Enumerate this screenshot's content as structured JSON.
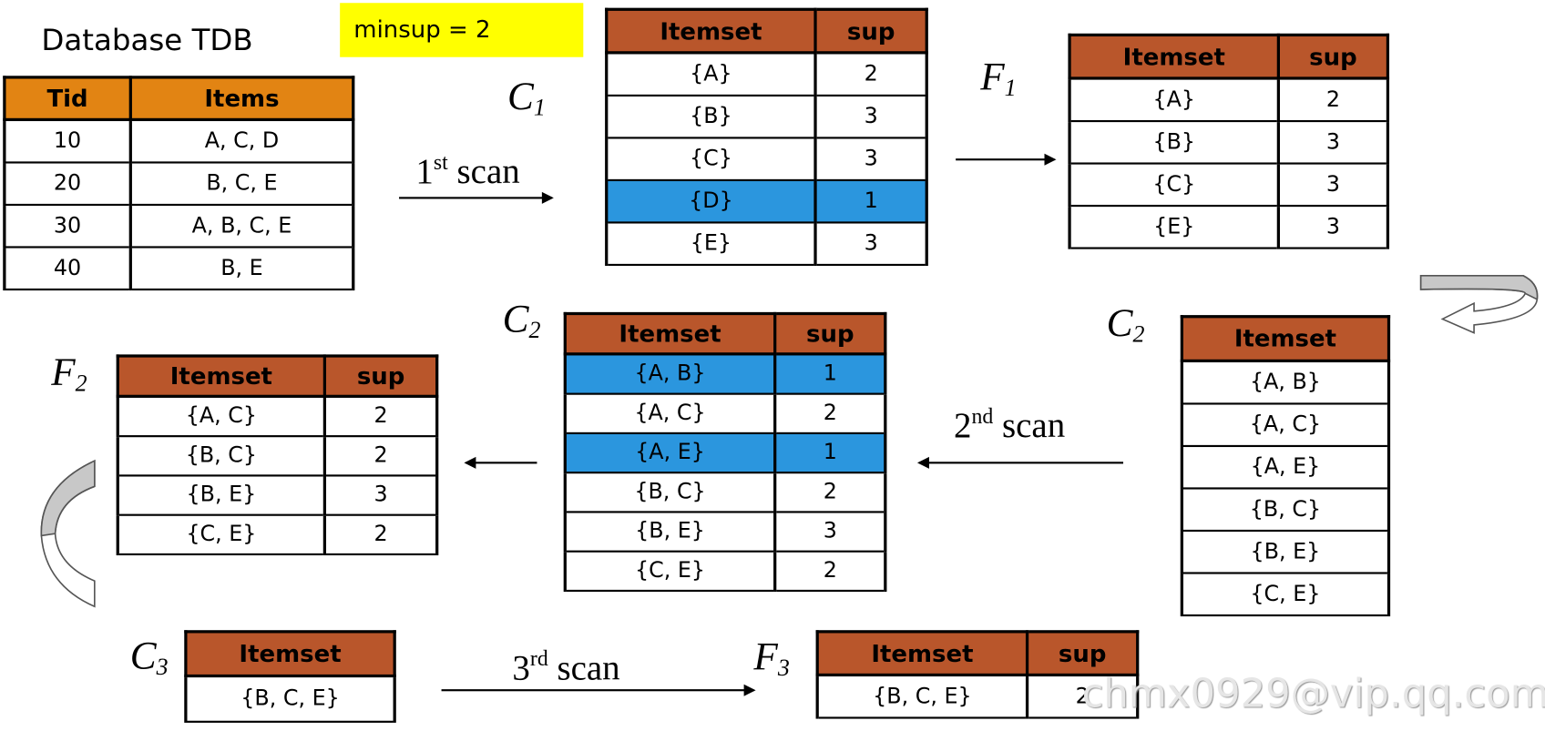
{
  "title": "Database TDB",
  "minsup": "minsup = 2",
  "colors": {
    "tdb_header": "#E28413",
    "itemset_header": "#B9562B",
    "pruned_row": "#2B96DE",
    "minsup_bg": "#FFFF00"
  },
  "labels": {
    "c1": {
      "letter": "C",
      "sub": "1"
    },
    "f1": {
      "letter": "F",
      "sub": "1"
    },
    "c2_right": {
      "letter": "C",
      "sub": "2"
    },
    "c2_mid": {
      "letter": "C",
      "sub": "2"
    },
    "f2": {
      "letter": "F",
      "sub": "2"
    },
    "c3": {
      "letter": "C",
      "sub": "3"
    },
    "f3": {
      "letter": "F",
      "sub": "3"
    }
  },
  "scans": {
    "first": {
      "num": "1",
      "sup": "st",
      "word": "scan"
    },
    "second": {
      "num": "2",
      "sup": "nd",
      "word": "scan"
    },
    "third": {
      "num": "3",
      "sup": "rd",
      "word": "scan"
    }
  },
  "tables": {
    "tdb": {
      "headers": [
        "Tid",
        "Items"
      ],
      "rows": [
        {
          "cells": [
            "10",
            "A, C, D"
          ]
        },
        {
          "cells": [
            "20",
            "B, C, E"
          ]
        },
        {
          "cells": [
            "30",
            "A, B, C, E"
          ]
        },
        {
          "cells": [
            "40",
            "B, E"
          ]
        }
      ]
    },
    "c1": {
      "headers": [
        "Itemset",
        "sup"
      ],
      "rows": [
        {
          "cells": [
            "{A}",
            "2"
          ]
        },
        {
          "cells": [
            "{B}",
            "3"
          ]
        },
        {
          "cells": [
            "{C}",
            "3"
          ]
        },
        {
          "cells": [
            "{D}",
            "1"
          ],
          "highlighted": true
        },
        {
          "cells": [
            "{E}",
            "3"
          ]
        }
      ]
    },
    "f1": {
      "headers": [
        "Itemset",
        "sup"
      ],
      "rows": [
        {
          "cells": [
            "{A}",
            "2"
          ]
        },
        {
          "cells": [
            "{B}",
            "3"
          ]
        },
        {
          "cells": [
            "{C}",
            "3"
          ]
        },
        {
          "cells": [
            "{E}",
            "3"
          ]
        }
      ]
    },
    "c2_right": {
      "headers": [
        "Itemset"
      ],
      "rows": [
        {
          "cells": [
            "{A, B}"
          ]
        },
        {
          "cells": [
            "{A, C}"
          ]
        },
        {
          "cells": [
            "{A, E}"
          ]
        },
        {
          "cells": [
            "{B, C}"
          ]
        },
        {
          "cells": [
            "{B, E}"
          ]
        },
        {
          "cells": [
            "{C, E}"
          ]
        }
      ]
    },
    "c2_mid": {
      "headers": [
        "Itemset",
        "sup"
      ],
      "rows": [
        {
          "cells": [
            "{A, B}",
            "1"
          ],
          "highlighted": true
        },
        {
          "cells": [
            "{A, C}",
            "2"
          ]
        },
        {
          "cells": [
            "{A, E}",
            "1"
          ],
          "highlighted": true
        },
        {
          "cells": [
            "{B, C}",
            "2"
          ]
        },
        {
          "cells": [
            "{B, E}",
            "3"
          ]
        },
        {
          "cells": [
            "{C, E}",
            "2"
          ]
        }
      ]
    },
    "f2": {
      "headers": [
        "Itemset",
        "sup"
      ],
      "rows": [
        {
          "cells": [
            "{A, C}",
            "2"
          ]
        },
        {
          "cells": [
            "{B, C}",
            "2"
          ]
        },
        {
          "cells": [
            "{B, E}",
            "3"
          ]
        },
        {
          "cells": [
            "{C, E}",
            "2"
          ]
        }
      ]
    },
    "c3": {
      "headers": [
        "Itemset"
      ],
      "rows": [
        {
          "cells": [
            "{B, C, E}"
          ]
        }
      ]
    },
    "f3": {
      "headers": [
        "Itemset",
        "sup"
      ],
      "rows": [
        {
          "cells": [
            "{B, C, E}",
            "2"
          ]
        }
      ]
    }
  },
  "watermark": "chmx0929@vip.qq.com"
}
